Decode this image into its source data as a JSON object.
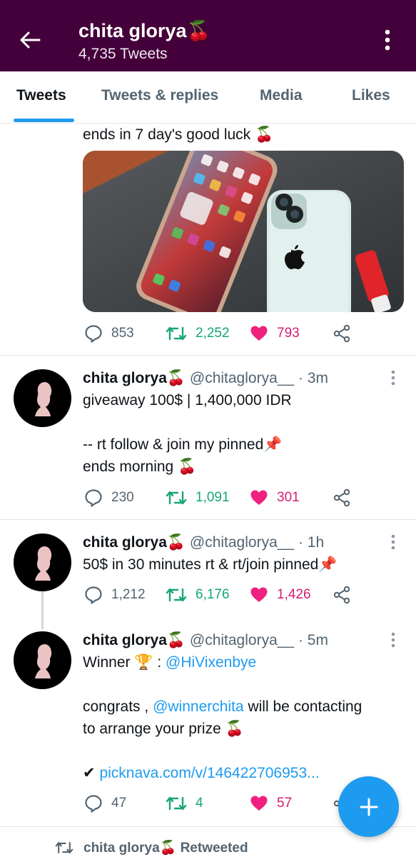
{
  "header": {
    "title": "chita glorya🍒",
    "subtitle": "4,735 Tweets",
    "background_color": "#44003a"
  },
  "tabs": [
    {
      "label": "Tweets",
      "active": true
    },
    {
      "label": "Tweets & replies",
      "active": false
    },
    {
      "label": "Media",
      "active": false
    },
    {
      "label": "Likes",
      "active": false
    }
  ],
  "tweets": [
    {
      "text_lines": [
        "ends in 7 day's good luck 🍒"
      ],
      "has_media": true,
      "replies": "853",
      "retweets": "2,252",
      "likes": "793"
    },
    {
      "name": "chita glorya🍒",
      "handle": "@chitaglorya__",
      "time": "· 3m",
      "text_lines": [
        "giveaway 100$ | 1,400,000 IDR",
        "",
        "-- rt follow & join my pinned📌",
        "ends morning 🍒"
      ],
      "replies": "230",
      "retweets": "1,091",
      "likes": "301"
    },
    {
      "name": "chita glorya🍒",
      "handle": "@chitaglorya__",
      "time": "· 1h",
      "text_lines": [
        "50$ in 30 minutes rt & rt/join pinned📌"
      ],
      "replies": "1,212",
      "retweets": "6,176",
      "likes": "1,426"
    },
    {
      "name": "chita glorya🍒",
      "handle": "@chitaglorya__",
      "time": "· 5m",
      "winner_prefix": "Winner 🏆 : ",
      "winner_mention": "@HiVixenbye",
      "congrats_prefix": "congrats , ",
      "congrats_mention": "@winnerchita",
      "congrats_suffix": " will be contacting",
      "line_prize": "to arrange your prize 🍒",
      "check": "✔ ",
      "link": "picknava.com/v/146422706953...",
      "replies": "47",
      "retweets": "4",
      "likes": "57"
    }
  ],
  "retweeted_label": "chita glorya🍒 Retweeted",
  "icons": {
    "back": "arrow-left-icon",
    "more": "more-vertical-icon",
    "reply": "reply-icon",
    "retweet": "retweet-icon",
    "like": "heart-icon",
    "share": "share-icon",
    "compose": "plus-icon"
  },
  "colors": {
    "accent": "#1d9bf0",
    "retweet": "#17a673",
    "like": "#d41d73"
  }
}
